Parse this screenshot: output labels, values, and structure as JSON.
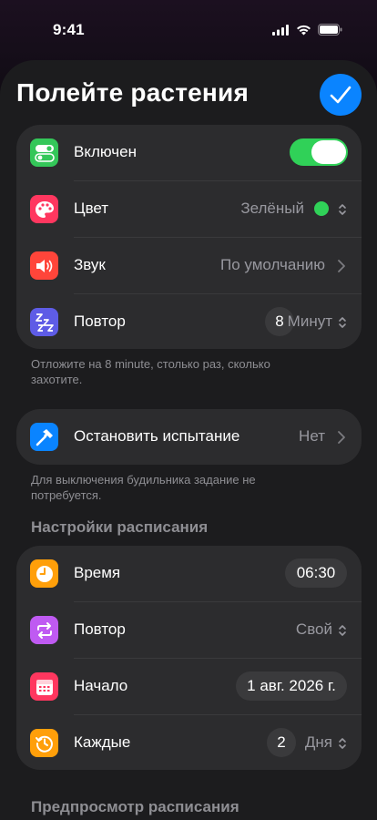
{
  "status_bar": {
    "time": "9:41"
  },
  "header": {
    "title": "Полейте растения"
  },
  "alarm_group": {
    "enabled_label": "Включен",
    "enabled_state": true,
    "color_label": "Цвет",
    "color_value": "Зелёный",
    "color_swatch": "#30d158",
    "sound_label": "Звук",
    "sound_value": "По умолчанию",
    "snooze_label": "Повтор",
    "snooze_number": "8",
    "snooze_unit": "Минут"
  },
  "snooze_footnote": "Отложите на 8 minute, столько раз, сколько захотите.",
  "challenge_group": {
    "label": "Остановить испытание",
    "value": "Нет"
  },
  "challenge_footnote": "Для выключения будильника задание не потребуется.",
  "schedule_header": "Настройки расписания",
  "schedule_group": {
    "time_label": "Время",
    "time_value": "06:30",
    "repeat_label": "Повтор",
    "repeat_value": "Свой",
    "start_label": "Начало",
    "start_value": "1 авг. 2026 г.",
    "every_label": "Каждые",
    "every_number": "2",
    "every_unit": "Дня"
  },
  "preview_header": "Предпросмотр расписания",
  "colors": {
    "accent": "#0a84ff",
    "toggle_on": "#30d158",
    "icon_enabled": "#34c759",
    "icon_color": "#ff375f",
    "icon_sound": "#ff453a",
    "icon_snooze": "#5e5ce6",
    "icon_challenge": "#0a84ff",
    "icon_time": "#ff9f0a",
    "icon_repeat": "#bf5af2",
    "icon_start": "#ff375f",
    "icon_every": "#ff9f0a"
  },
  "icons": {
    "enabled": "toggle-switch-icon",
    "color": "palette-icon",
    "sound": "speaker-icon",
    "snooze": "zzz-icon",
    "challenge": "hammer-icon",
    "time": "clock-icon",
    "repeat": "repeat-arrows-icon",
    "start": "calendar-icon",
    "every": "history-clock-icon"
  }
}
